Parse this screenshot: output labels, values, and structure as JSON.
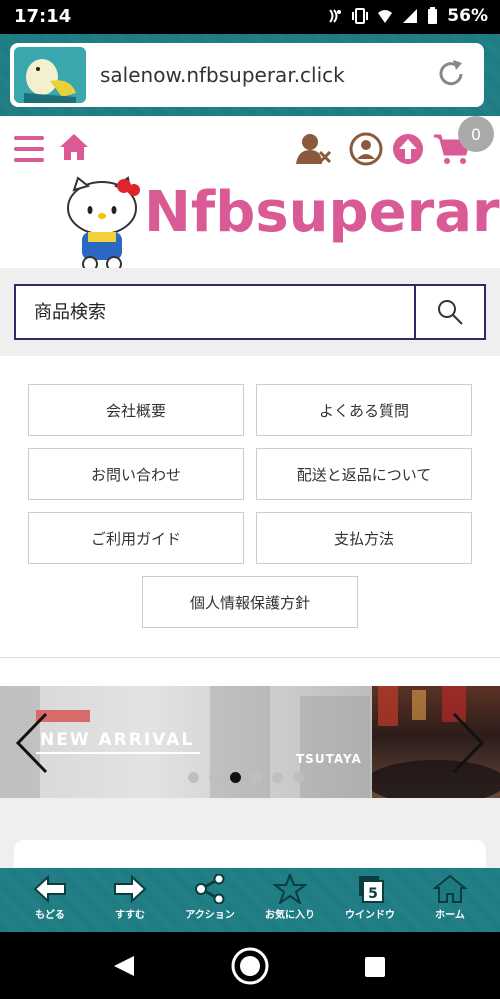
{
  "status_bar": {
    "time": "17:14",
    "battery": "56%",
    "icons": [
      "nfc-icon",
      "vibrate-icon",
      "wifi-icon",
      "signal-icon",
      "battery-icon"
    ]
  },
  "browser": {
    "url": "salenow.nfbsuperar.click"
  },
  "header": {
    "logo_text": "Nfbsuperar",
    "cart_count": "0",
    "colors": {
      "accent": "#d95a95",
      "icon_brown": "#8b5a3c"
    }
  },
  "search": {
    "placeholder": "商品検索"
  },
  "links": [
    "会社概要",
    "よくある質問",
    "お問い合わせ",
    "配送と返品について",
    "ご利用ガイド",
    "支払方法",
    "個人情報保護方針"
  ],
  "carousel": {
    "slide_title": "NEW ARRIVAL",
    "sign_text": "TSUTAYA",
    "active_dot": 3,
    "dot_count": 6
  },
  "toolbar": {
    "items": [
      "もどる",
      "すすむ",
      "アクション",
      "お気に入り",
      "ウインドウ",
      "ホーム"
    ],
    "window_count": "5"
  },
  "nav": {
    "icons": [
      "back-triangle-icon",
      "home-circle-icon",
      "recents-square-icon"
    ]
  }
}
